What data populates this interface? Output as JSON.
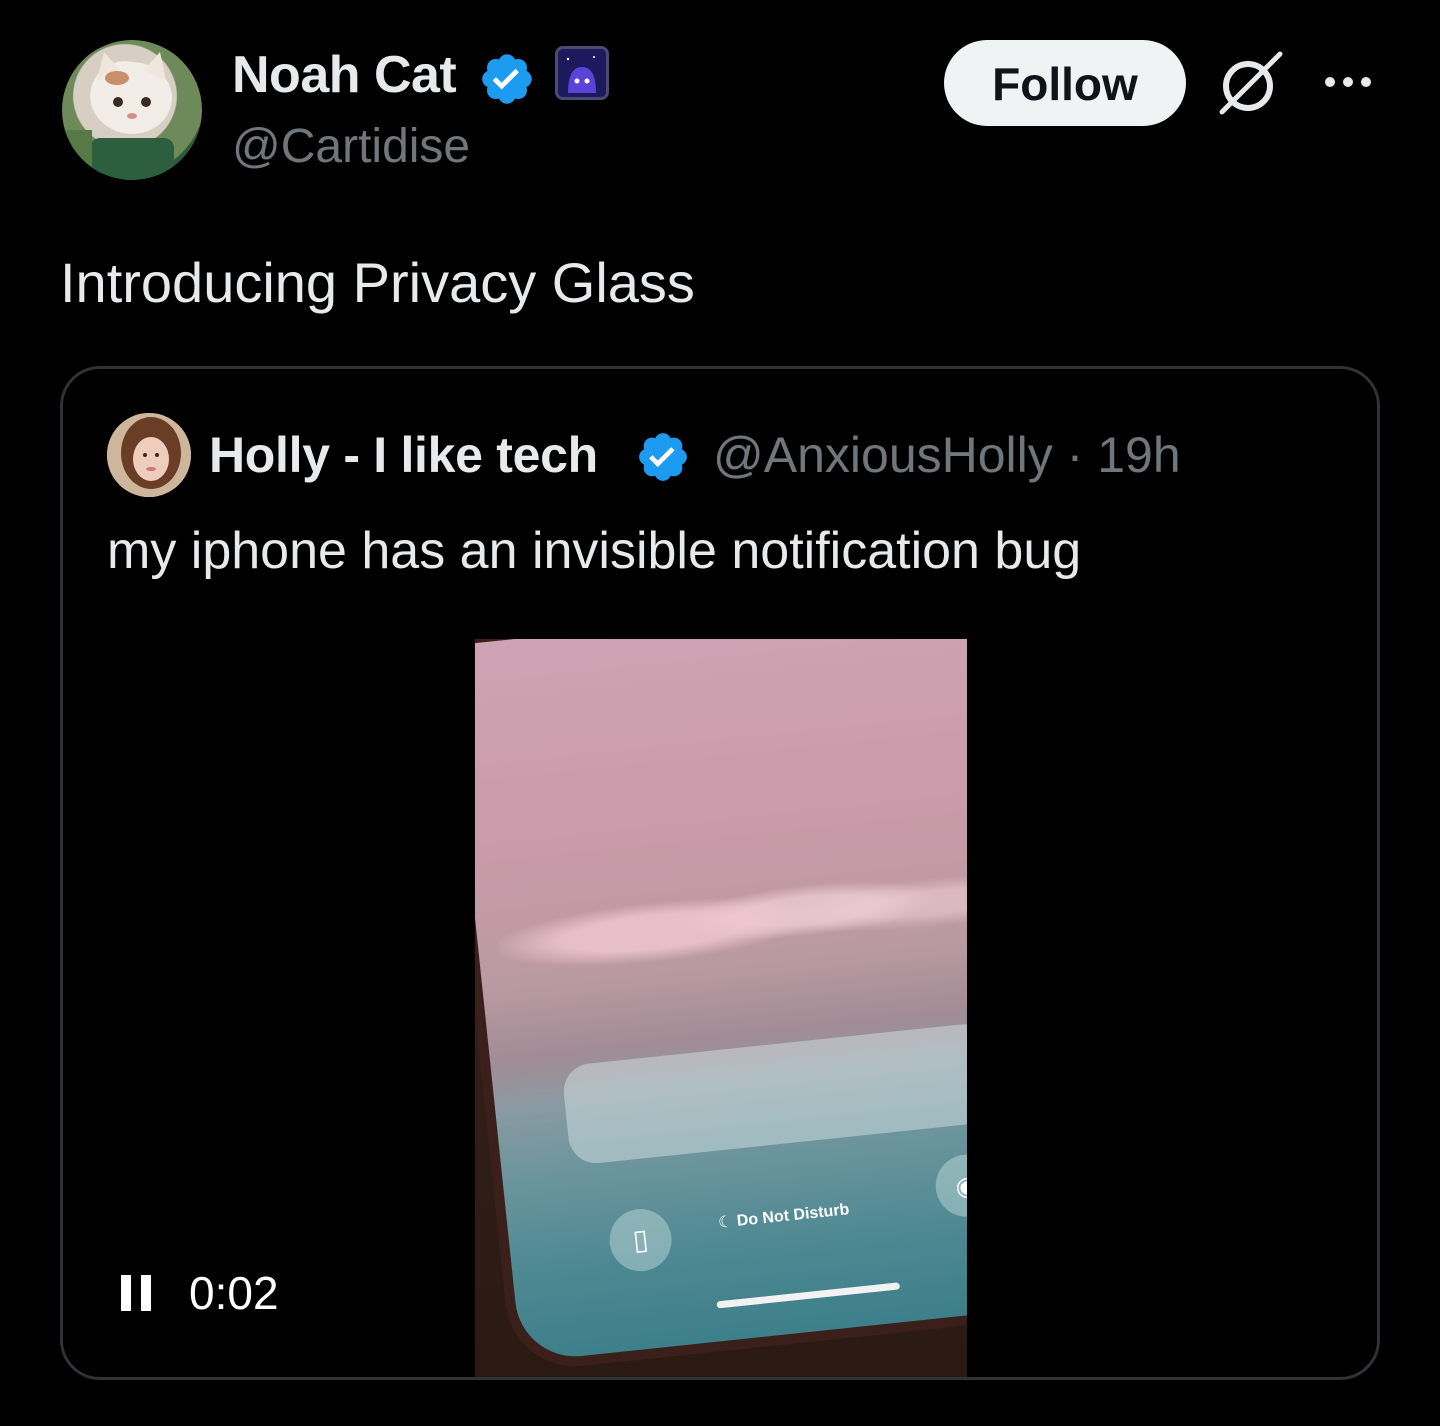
{
  "author": {
    "display_name": "Noah Cat",
    "handle": "@Cartidise"
  },
  "actions": {
    "follow_label": "Follow"
  },
  "tweet": {
    "text": "Introducing Privacy Glass"
  },
  "quoted_tweet": {
    "display_name": "Holly - I like tech",
    "meta": "@AnxiousHolly · 19h",
    "text": "my iphone has an invisible notification bug",
    "media": {
      "dnd_label": "Do Not Disturb",
      "timestamp": "0:02"
    }
  },
  "colors": {
    "background": "#000000",
    "verified_blue": "#1d9bf0",
    "secondary_text": "#71767b",
    "follow_button_bg": "#eff3f4"
  },
  "icons": {
    "verified": "verified-badge-icon",
    "affiliate": "affiliate-badge-icon",
    "grok": "grok-icon",
    "more": "more-icon",
    "pause": "pause-icon",
    "flashlight": "flashlight-icon",
    "camera": "camera-icon",
    "moon": "moon-icon"
  }
}
